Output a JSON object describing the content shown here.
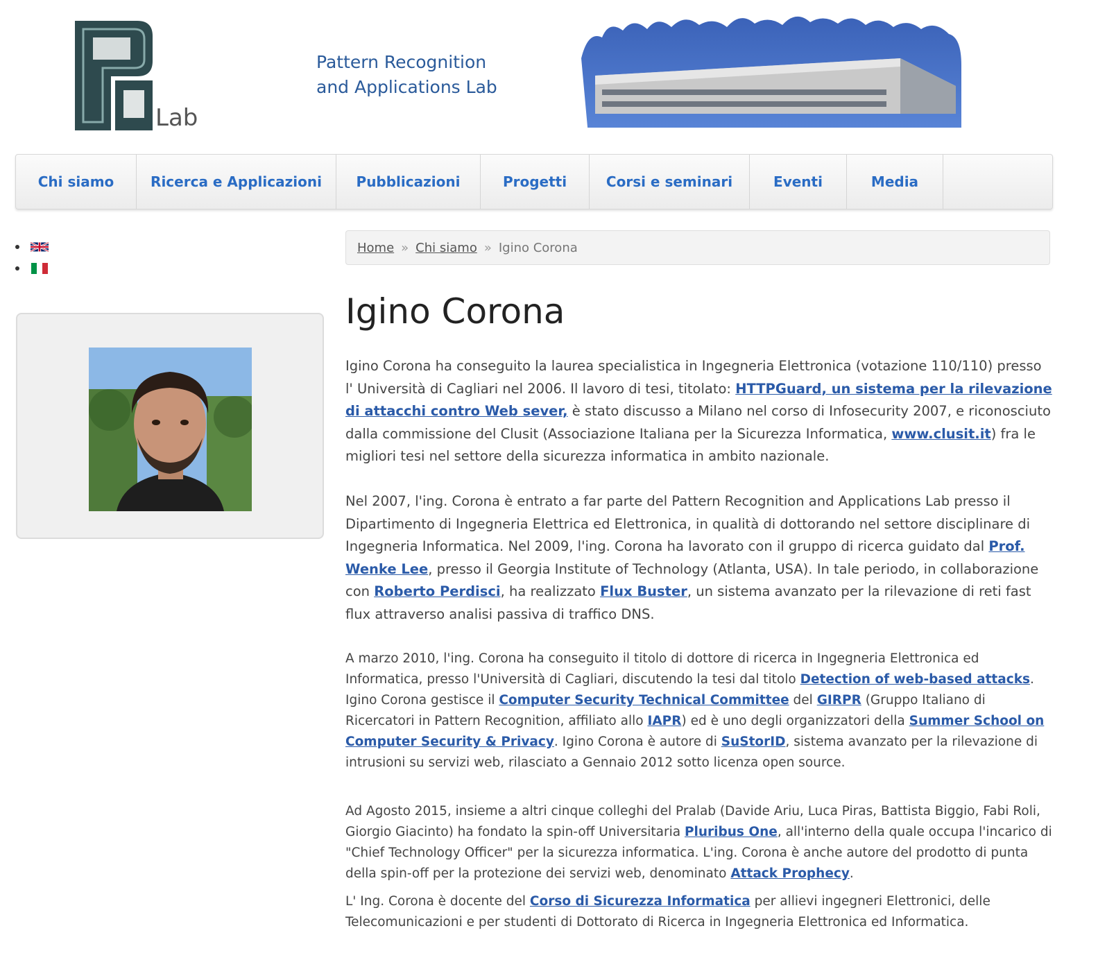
{
  "header": {
    "logo_lab": "Lab",
    "tagline_line1": "Pattern Recognition",
    "tagline_line2": "and Applications Lab"
  },
  "nav": [
    {
      "label": "Chi siamo"
    },
    {
      "label": "Ricerca e Applicazioni"
    },
    {
      "label": "Pubblicazioni"
    },
    {
      "label": "Progetti"
    },
    {
      "label": "Corsi e seminari"
    },
    {
      "label": "Eventi"
    },
    {
      "label": "Media"
    }
  ],
  "languages": [
    "uk-flag-icon",
    "italy-flag-icon"
  ],
  "breadcrumb": {
    "home": "Home",
    "section": "Chi siamo",
    "sep": "»",
    "current": "Igino Corona"
  },
  "page_title": "Igino Corona",
  "paragraphs": {
    "p1": {
      "t1": "Igino Corona ha conseguito la laurea specialistica in Ingegneria Elettronica (votazione 110/110) presso l' Università di Cagliari nel 2006. Il lavoro di tesi, titolato: ",
      "l1": "HTTPGuard, un sistema per la rilevazione di attacchi contro Web sever,",
      "t2": " è stato discusso a Milano nel corso di Infosecurity 2007, e riconosciuto dalla commissione del Clusit (Associazione Italiana per la Sicurezza Informatica, ",
      "l2": "www.clusit.it",
      "t3": ") fra le migliori tesi nel settore della sicurezza informatica in ambito nazionale."
    },
    "p2": {
      "t1": "Nel 2007, l'ing. Corona è entrato a far parte del Pattern Recognition and Applications Lab presso il Dipartimento di Ingegneria Elettrica ed Elettronica, in qualità di dottorando nel settore disciplinare di Ingegneria Informatica. Nel 2009, l'ing. Corona ha lavorato con il gruppo di ricerca guidato dal ",
      "l1": "Prof. Wenke Lee",
      "t2": ", presso il Georgia Institute of Technology (Atlanta, USA). In tale periodo, in collaborazione con ",
      "l2": "Roberto Perdisci",
      "t3": ", ha realizzato ",
      "l3": "Flux Buster",
      "t4": ", un sistema avanzato per la rilevazione di reti fast flux attraverso analisi passiva di traffico DNS."
    },
    "p3": {
      "t1": "A marzo 2010, l'ing. Corona ha conseguito il titolo di dottore di ricerca in Ingegneria Elettronica ed Informatica, presso l'Università di Cagliari, discutendo la tesi dal titolo ",
      "l1": "Detection of web-based attacks",
      "t2": ". Igino Corona gestisce il ",
      "l2": "Computer Security Technical Committee",
      "t3": " del ",
      "l3": "GIRPR",
      "t4": " (Gruppo Italiano di Ricercatori in Pattern Recognition, affiliato allo ",
      "l4": "IAPR",
      "t5": ") ed è uno degli organizzatori della ",
      "l5": "Summer School on Computer Security & Privacy",
      "t6": ". Igino Corona è autore di ",
      "l6": "SuStorID",
      "t7": ", sistema avanzato per la rilevazione di intrusioni su servizi web, rilasciato a Gennaio 2012 sotto licenza open source."
    },
    "p4": {
      "t1": "Ad Agosto 2015, insieme a altri cinque colleghi del Pralab (Davide Ariu, Luca Piras, Battista Biggio, Fabi Roli, Giorgio Giacinto) ha fondato la spin-off Universitaria ",
      "l1": "Pluribus One",
      "t2": ", all'interno della quale occupa l'incarico di \"Chief Technology Officer\" per la sicurezza informatica. L'ing. Corona è anche autore del prodotto di punta della spin-off per la protezione dei servizi web, denominato ",
      "l2": "Attack Prophecy",
      "t3": "."
    },
    "p5": {
      "t1": "L' Ing. Corona è docente del ",
      "l1": "Corso di Sicurezza Informatica",
      "t2": " per allievi ingegneri Elettronici, delle Telecomunicazioni e per studenti di Dottorato di Ricerca in Ingegneria Elettronica ed Informatica."
    }
  },
  "colors": {
    "link": "#2a5aa8",
    "nav_text": "#2a6cc4",
    "tagline": "#2a5a9a"
  }
}
